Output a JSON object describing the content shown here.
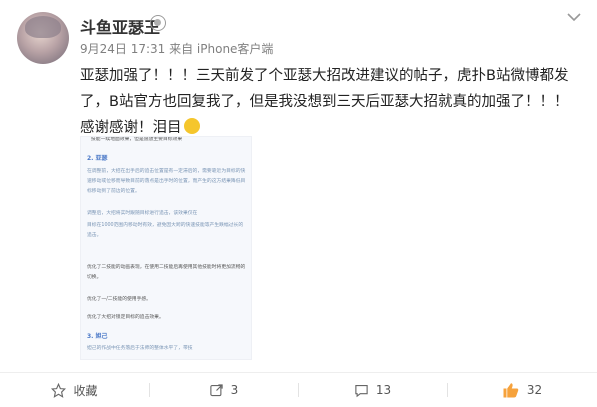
{
  "post": {
    "username": "斗鱼亚瑟王",
    "meta": "9月24日 17:31 来自 iPhone客户端",
    "text": "亚瑟加强了！！！三天前发了个亚瑟大招改进建议的帖子，虎扑B站微博都发了，B站官方也回复我了，但是我没想到三天后亚瑟大招就真的加强了！！！感谢感谢！泪目"
  },
  "image": {
    "line_top": "技能一续地面效果，但是施放主要目标效果",
    "h2": "2.    亚瑟",
    "p1": "在调整前，大招在出手后的追击位置是有一定滞后的，需要靠近为目标的快速移动或位移而导致目前的落点是出手时的位置，而产生的这方结果降低目标移动到了前边的位置。",
    "p2": "调整后，大招将实时跟随目标进行追击，该效果仅在",
    "p3": "目标在1000范围内移动时有效，避免因大跨的快速技能等产生跌幅过长的追击。",
    "p4": "优化了二技能的动画表现，在使用二技能后再使用其他技能时将更加流畅的切换。",
    "p5": "优化了一/二技能的使用手感。",
    "p6": "优化了大招对锁定目标的追击效果。",
    "h3": "3.    妲己",
    "p7": "妲己的作战中任务落后于法师的整体水平了，带技"
  },
  "footer": {
    "favorite": "收藏",
    "repost": "3",
    "comment": "13",
    "like": "32"
  },
  "icons": [
    "vip-badge-icon",
    "chevron-down-icon",
    "emoji-crying-icon",
    "star-icon",
    "repost-icon",
    "comment-icon",
    "like-icon"
  ],
  "colors": {
    "text": "#333333",
    "meta": "#808080",
    "like": "#f6a23c",
    "link": "#4a78c7"
  }
}
